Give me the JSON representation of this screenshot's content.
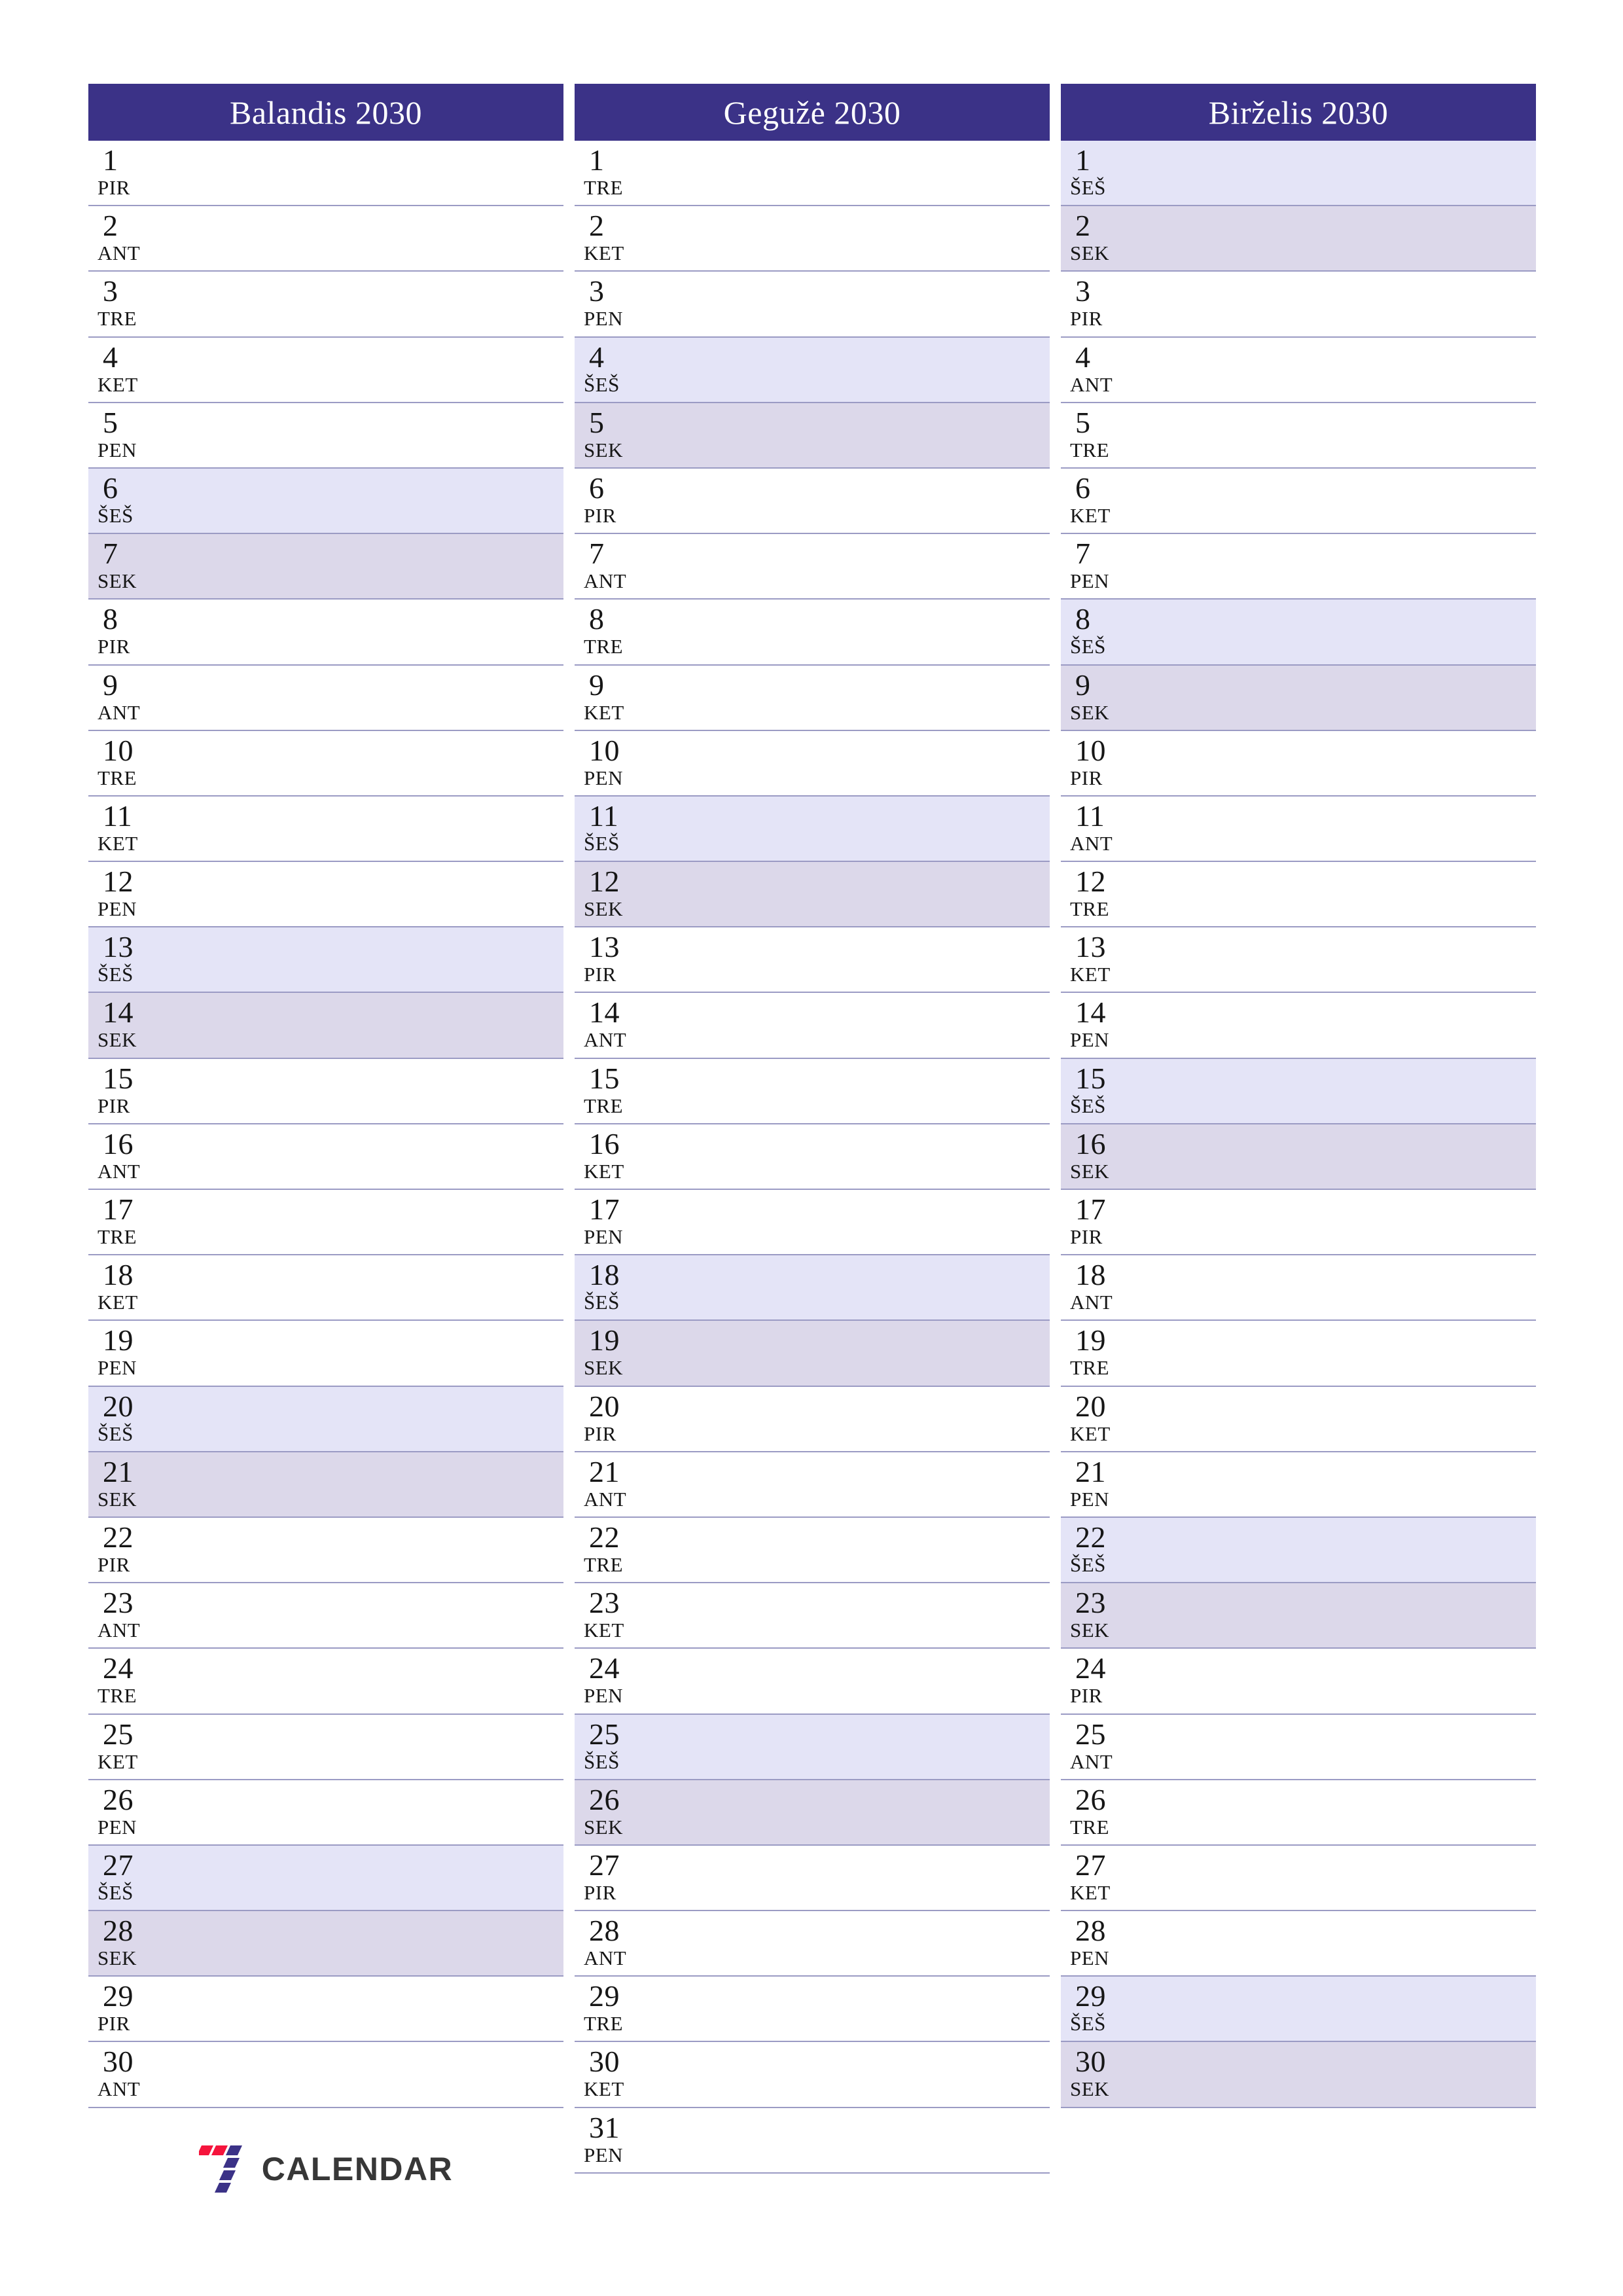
{
  "document": {
    "type": "three-month-planner",
    "year": "2030",
    "language": "lt",
    "page_size": "A4-portrait"
  },
  "colors": {
    "header_bg": "#3b3287",
    "header_text": "#ffffff",
    "saturday_bg": "#e4e4f7",
    "sunday_bg": "#dcd8ea",
    "rule": "#9b9bc4",
    "page_bg": "#ffffff",
    "logo_red": "#f5143c",
    "logo_indigo": "#3b3287",
    "logo_text": "#373737"
  },
  "weekday_abbr": {
    "mon": "PIR",
    "tue": "ANT",
    "wed": "TRE",
    "thu": "KET",
    "fri": "PEN",
    "sat": "ŠEŠ",
    "sun": "SEK"
  },
  "months": [
    {
      "title": "Balandis 2030",
      "days": [
        {
          "n": "1",
          "wd": "PIR",
          "type": "weekday"
        },
        {
          "n": "2",
          "wd": "ANT",
          "type": "weekday"
        },
        {
          "n": "3",
          "wd": "TRE",
          "type": "weekday"
        },
        {
          "n": "4",
          "wd": "KET",
          "type": "weekday"
        },
        {
          "n": "5",
          "wd": "PEN",
          "type": "weekday"
        },
        {
          "n": "6",
          "wd": "ŠEŠ",
          "type": "sat"
        },
        {
          "n": "7",
          "wd": "SEK",
          "type": "sun"
        },
        {
          "n": "8",
          "wd": "PIR",
          "type": "weekday"
        },
        {
          "n": "9",
          "wd": "ANT",
          "type": "weekday"
        },
        {
          "n": "10",
          "wd": "TRE",
          "type": "weekday"
        },
        {
          "n": "11",
          "wd": "KET",
          "type": "weekday"
        },
        {
          "n": "12",
          "wd": "PEN",
          "type": "weekday"
        },
        {
          "n": "13",
          "wd": "ŠEŠ",
          "type": "sat"
        },
        {
          "n": "14",
          "wd": "SEK",
          "type": "sun"
        },
        {
          "n": "15",
          "wd": "PIR",
          "type": "weekday"
        },
        {
          "n": "16",
          "wd": "ANT",
          "type": "weekday"
        },
        {
          "n": "17",
          "wd": "TRE",
          "type": "weekday"
        },
        {
          "n": "18",
          "wd": "KET",
          "type": "weekday"
        },
        {
          "n": "19",
          "wd": "PEN",
          "type": "weekday"
        },
        {
          "n": "20",
          "wd": "ŠEŠ",
          "type": "sat"
        },
        {
          "n": "21",
          "wd": "SEK",
          "type": "sun"
        },
        {
          "n": "22",
          "wd": "PIR",
          "type": "weekday"
        },
        {
          "n": "23",
          "wd": "ANT",
          "type": "weekday"
        },
        {
          "n": "24",
          "wd": "TRE",
          "type": "weekday"
        },
        {
          "n": "25",
          "wd": "KET",
          "type": "weekday"
        },
        {
          "n": "26",
          "wd": "PEN",
          "type": "weekday"
        },
        {
          "n": "27",
          "wd": "ŠEŠ",
          "type": "sat"
        },
        {
          "n": "28",
          "wd": "SEK",
          "type": "sun"
        },
        {
          "n": "29",
          "wd": "PIR",
          "type": "weekday"
        },
        {
          "n": "30",
          "wd": "ANT",
          "type": "weekday"
        }
      ]
    },
    {
      "title": "Gegužė 2030",
      "days": [
        {
          "n": "1",
          "wd": "TRE",
          "type": "weekday"
        },
        {
          "n": "2",
          "wd": "KET",
          "type": "weekday"
        },
        {
          "n": "3",
          "wd": "PEN",
          "type": "weekday"
        },
        {
          "n": "4",
          "wd": "ŠEŠ",
          "type": "sat"
        },
        {
          "n": "5",
          "wd": "SEK",
          "type": "sun"
        },
        {
          "n": "6",
          "wd": "PIR",
          "type": "weekday"
        },
        {
          "n": "7",
          "wd": "ANT",
          "type": "weekday"
        },
        {
          "n": "8",
          "wd": "TRE",
          "type": "weekday"
        },
        {
          "n": "9",
          "wd": "KET",
          "type": "weekday"
        },
        {
          "n": "10",
          "wd": "PEN",
          "type": "weekday"
        },
        {
          "n": "11",
          "wd": "ŠEŠ",
          "type": "sat"
        },
        {
          "n": "12",
          "wd": "SEK",
          "type": "sun"
        },
        {
          "n": "13",
          "wd": "PIR",
          "type": "weekday"
        },
        {
          "n": "14",
          "wd": "ANT",
          "type": "weekday"
        },
        {
          "n": "15",
          "wd": "TRE",
          "type": "weekday"
        },
        {
          "n": "16",
          "wd": "KET",
          "type": "weekday"
        },
        {
          "n": "17",
          "wd": "PEN",
          "type": "weekday"
        },
        {
          "n": "18",
          "wd": "ŠEŠ",
          "type": "sat"
        },
        {
          "n": "19",
          "wd": "SEK",
          "type": "sun"
        },
        {
          "n": "20",
          "wd": "PIR",
          "type": "weekday"
        },
        {
          "n": "21",
          "wd": "ANT",
          "type": "weekday"
        },
        {
          "n": "22",
          "wd": "TRE",
          "type": "weekday"
        },
        {
          "n": "23",
          "wd": "KET",
          "type": "weekday"
        },
        {
          "n": "24",
          "wd": "PEN",
          "type": "weekday"
        },
        {
          "n": "25",
          "wd": "ŠEŠ",
          "type": "sat"
        },
        {
          "n": "26",
          "wd": "SEK",
          "type": "sun"
        },
        {
          "n": "27",
          "wd": "PIR",
          "type": "weekday"
        },
        {
          "n": "28",
          "wd": "ANT",
          "type": "weekday"
        },
        {
          "n": "29",
          "wd": "TRE",
          "type": "weekday"
        },
        {
          "n": "30",
          "wd": "KET",
          "type": "weekday"
        },
        {
          "n": "31",
          "wd": "PEN",
          "type": "weekday"
        }
      ]
    },
    {
      "title": "Birželis 2030",
      "days": [
        {
          "n": "1",
          "wd": "ŠEŠ",
          "type": "sat"
        },
        {
          "n": "2",
          "wd": "SEK",
          "type": "sun"
        },
        {
          "n": "3",
          "wd": "PIR",
          "type": "weekday"
        },
        {
          "n": "4",
          "wd": "ANT",
          "type": "weekday"
        },
        {
          "n": "5",
          "wd": "TRE",
          "type": "weekday"
        },
        {
          "n": "6",
          "wd": "KET",
          "type": "weekday"
        },
        {
          "n": "7",
          "wd": "PEN",
          "type": "weekday"
        },
        {
          "n": "8",
          "wd": "ŠEŠ",
          "type": "sat"
        },
        {
          "n": "9",
          "wd": "SEK",
          "type": "sun"
        },
        {
          "n": "10",
          "wd": "PIR",
          "type": "weekday"
        },
        {
          "n": "11",
          "wd": "ANT",
          "type": "weekday"
        },
        {
          "n": "12",
          "wd": "TRE",
          "type": "weekday"
        },
        {
          "n": "13",
          "wd": "KET",
          "type": "weekday"
        },
        {
          "n": "14",
          "wd": "PEN",
          "type": "weekday"
        },
        {
          "n": "15",
          "wd": "ŠEŠ",
          "type": "sat"
        },
        {
          "n": "16",
          "wd": "SEK",
          "type": "sun"
        },
        {
          "n": "17",
          "wd": "PIR",
          "type": "weekday"
        },
        {
          "n": "18",
          "wd": "ANT",
          "type": "weekday"
        },
        {
          "n": "19",
          "wd": "TRE",
          "type": "weekday"
        },
        {
          "n": "20",
          "wd": "KET",
          "type": "weekday"
        },
        {
          "n": "21",
          "wd": "PEN",
          "type": "weekday"
        },
        {
          "n": "22",
          "wd": "ŠEŠ",
          "type": "sat"
        },
        {
          "n": "23",
          "wd": "SEK",
          "type": "sun"
        },
        {
          "n": "24",
          "wd": "PIR",
          "type": "weekday"
        },
        {
          "n": "25",
          "wd": "ANT",
          "type": "weekday"
        },
        {
          "n": "26",
          "wd": "TRE",
          "type": "weekday"
        },
        {
          "n": "27",
          "wd": "KET",
          "type": "weekday"
        },
        {
          "n": "28",
          "wd": "PEN",
          "type": "weekday"
        },
        {
          "n": "29",
          "wd": "ŠEŠ",
          "type": "sat"
        },
        {
          "n": "30",
          "wd": "SEK",
          "type": "sun"
        }
      ]
    }
  ],
  "logo": {
    "mark": "seven-logo-icon",
    "text": "CALENDAR"
  }
}
